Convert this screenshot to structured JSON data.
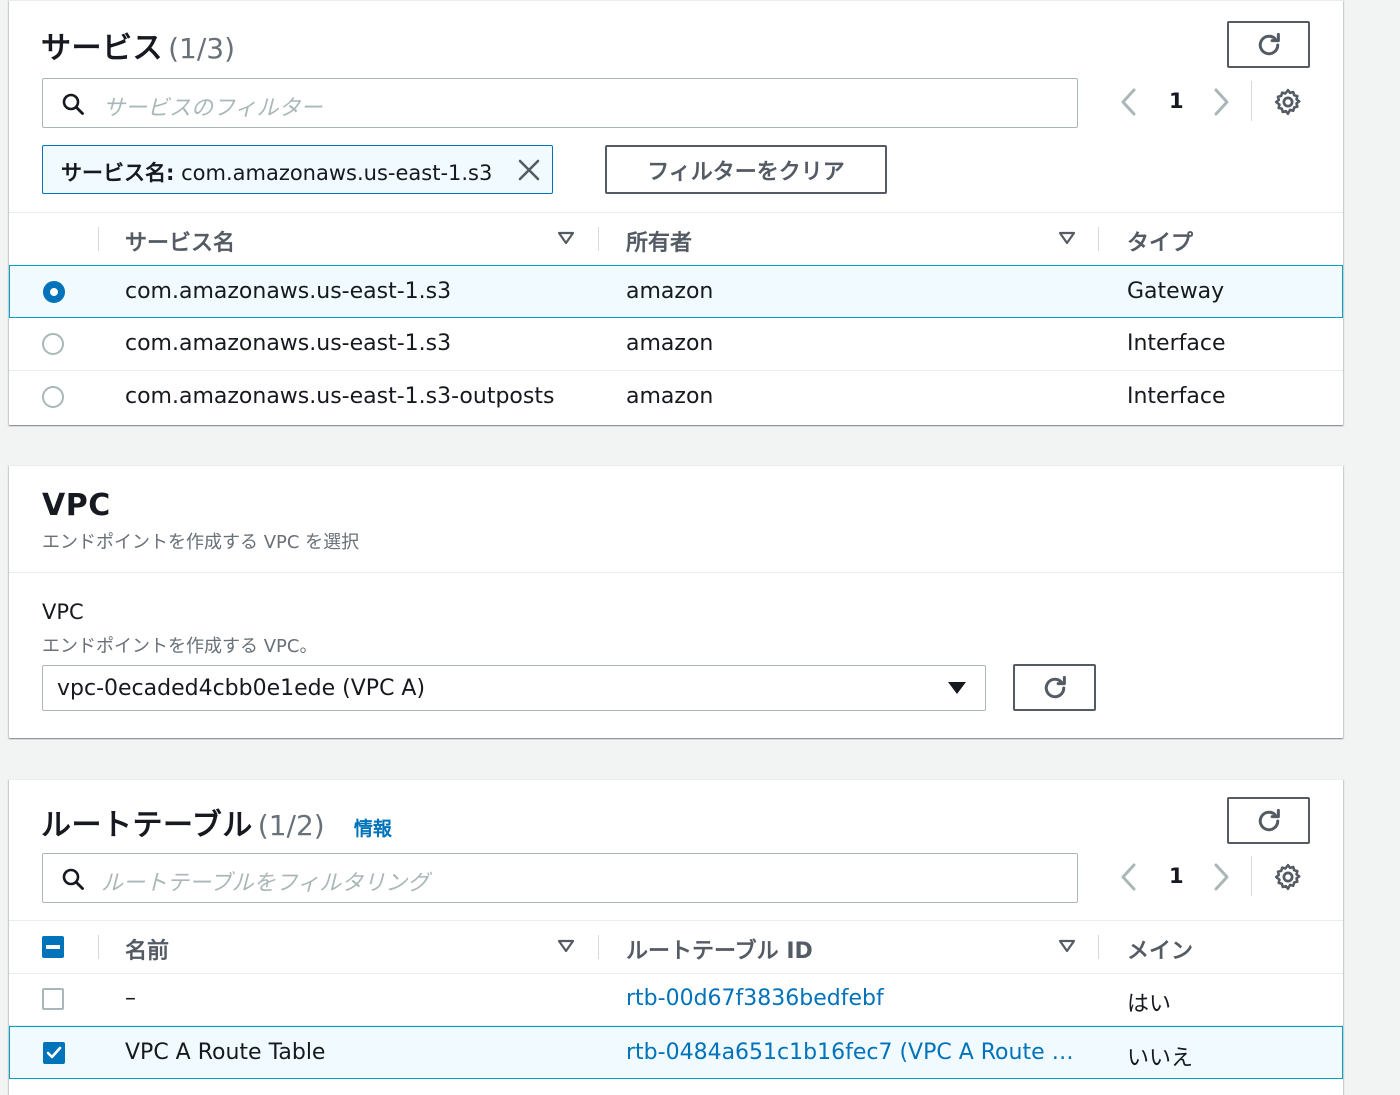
{
  "services": {
    "title": "サービス",
    "count": "(1/3)",
    "search_placeholder": "サービスのフィルター",
    "page": "1",
    "token_key": "サービス名:",
    "token_value": "com.amazonaws.us-east-1.s3",
    "clear_filter_label": "フィルターをクリア",
    "columns": [
      "サービス名",
      "所有者",
      "タイプ"
    ],
    "rows": [
      {
        "name": "com.amazonaws.us-east-1.s3",
        "owner": "amazon",
        "type": "Gateway",
        "selected": true
      },
      {
        "name": "com.amazonaws.us-east-1.s3",
        "owner": "amazon",
        "type": "Interface",
        "selected": false
      },
      {
        "name": "com.amazonaws.us-east-1.s3-outposts",
        "owner": "amazon",
        "type": "Interface",
        "selected": false
      }
    ]
  },
  "vpc": {
    "title": "VPC",
    "description": "エンドポイントを作成する VPC を選択",
    "field_label": "VPC",
    "field_description": "エンドポイントを作成する VPC。",
    "selected_value": "vpc-0ecaded4cbb0e1ede (VPC A)"
  },
  "route_tables": {
    "title": "ルートテーブル",
    "count": "(1/2)",
    "info_label": "情報",
    "search_placeholder": "ルートテーブルをフィルタリング",
    "page": "1",
    "columns": [
      "名前",
      "ルートテーブル ID",
      "メイン"
    ],
    "rows": [
      {
        "name": "–",
        "id": "rtb-00d67f3836bedfebf",
        "main": "はい",
        "checked": false
      },
      {
        "name": "VPC A Route Table",
        "id": "rtb-0484a651c1b16fec7 (VPC A Route …",
        "main": "いいえ",
        "checked": true
      }
    ]
  },
  "colors": {
    "accent": "#0073bb",
    "selected_row_bg": "#f1faff",
    "selected_row_border": "#00a1c9"
  }
}
